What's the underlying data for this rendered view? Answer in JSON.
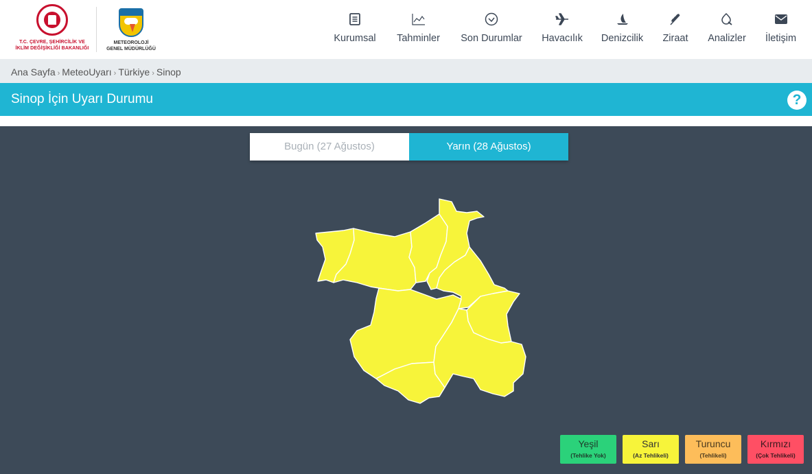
{
  "header": {
    "ministry_text_line1": "T.C. ÇEVRE, ŞEHİRCİLİK VE",
    "ministry_text_line2": "İKLİM DEĞİŞİKLİĞİ BAKANLIĞI",
    "mgm_text_line1": "METEOROLOJİ",
    "mgm_text_line2": "GENEL MÜDÜRLÜĞÜ",
    "nav": [
      {
        "label": "Kurumsal",
        "icon": "document-icon"
      },
      {
        "label": "Tahminler",
        "icon": "chart-icon"
      },
      {
        "label": "Son Durumlar",
        "icon": "check-circle-icon"
      },
      {
        "label": "Havacılık",
        "icon": "plane-icon"
      },
      {
        "label": "Denizcilik",
        "icon": "sailboat-icon"
      },
      {
        "label": "Ziraat",
        "icon": "wheat-icon"
      },
      {
        "label": "Analizler",
        "icon": "analysis-icon"
      },
      {
        "label": "İletişim",
        "icon": "envelope-icon"
      }
    ]
  },
  "breadcrumb": [
    "Ana Sayfa",
    "MeteoUyarı",
    "Türkiye",
    "Sinop"
  ],
  "page_title": "Sinop İçin Uyarı Durumu",
  "help_label": "?",
  "tabs": [
    {
      "label": "Bugün (27 Ağustos)",
      "active": false
    },
    {
      "label": "Yarın (28 Ağustos)",
      "active": true
    }
  ],
  "map": {
    "region": "Sinop",
    "districts_warning_level": "Sarı",
    "fill_color": "#f7f43a"
  },
  "legend": [
    {
      "name": "Yeşil",
      "desc": "(Tehlike Yok)",
      "color": "#2bd27a",
      "text_color": "#1f3b2a"
    },
    {
      "name": "Sarı",
      "desc": "(Az Tehlikeli)",
      "color": "#f7f43a",
      "text_color": "#333333"
    },
    {
      "name": "Turuncu",
      "desc": "(Tehlikeli)",
      "color": "#fdbd5a",
      "text_color": "#4a3a1f"
    },
    {
      "name": "Kırmızı",
      "desc": "(Çok Tehlikeli)",
      "color": "#ff4f64",
      "text_color": "#3a1a1f"
    }
  ],
  "colors": {
    "accent": "#1fb5d3",
    "main_bg": "#3d4a58",
    "breadcrumb_bg": "#e8ecef"
  }
}
